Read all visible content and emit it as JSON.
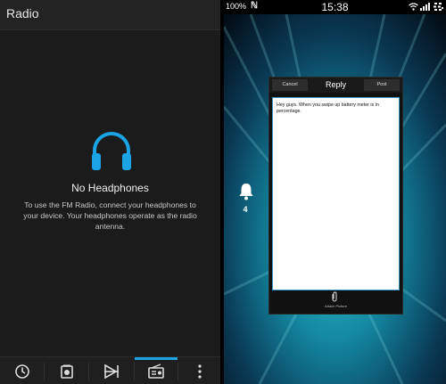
{
  "left": {
    "title": "Radio",
    "message_title": "No Headphones",
    "message_body": "To use the FM Radio, connect your headphones to your device. Your headphones operate as the radio antenna.",
    "bottom_bar": [
      {
        "icon": "history-icon"
      },
      {
        "icon": "stations-icon"
      },
      {
        "icon": "scan-icon"
      },
      {
        "icon": "radio-icon",
        "active": true
      },
      {
        "icon": "overflow-menu-icon"
      }
    ],
    "accent_color": "#1aa4e6"
  },
  "right": {
    "status": {
      "battery": "100%",
      "clock": "15:38"
    },
    "notification_count": "4",
    "reply": {
      "cancel_label": "Cancel",
      "title": "Reply",
      "post_label": "Post",
      "body": "Hey guys. When you swipe up battery meter is in percentage.",
      "attach_label": "Attach Picture"
    }
  }
}
